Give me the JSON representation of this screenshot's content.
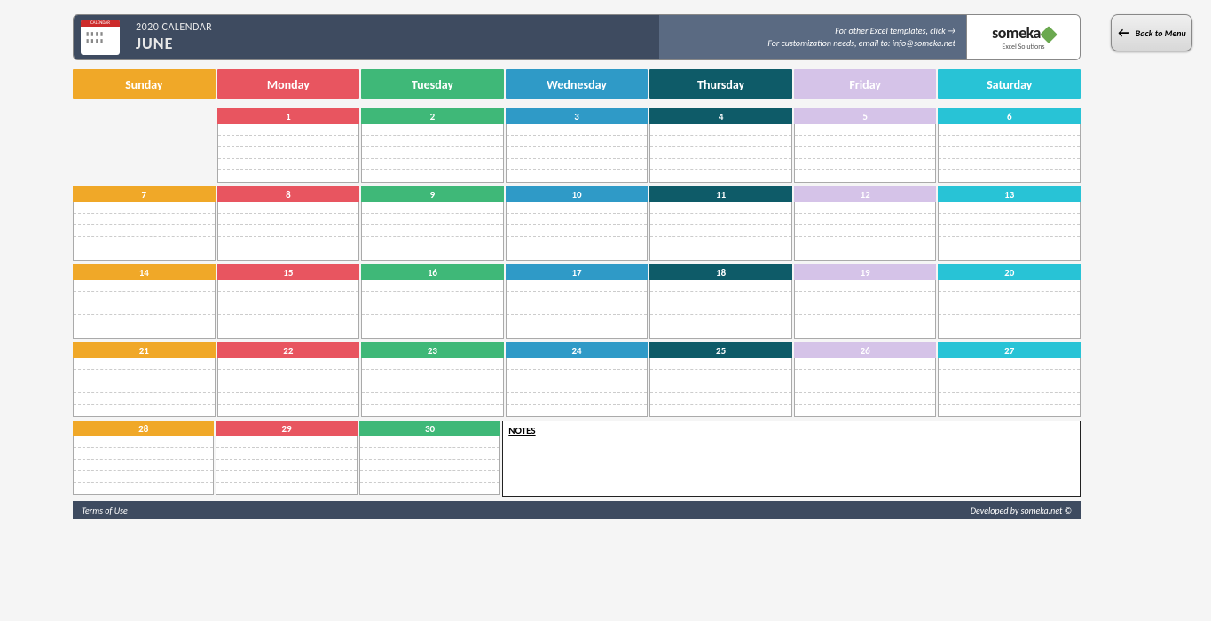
{
  "header": {
    "year_label": "2020 CALENDAR",
    "month": "JUNE",
    "templates_text": "For other Excel templates, click →",
    "custom_text": "For customization needs, email to: info@someka.net",
    "logo_name": "someka",
    "logo_sub": "Excel Solutions"
  },
  "back_button": "Back to Menu",
  "days": [
    "Sunday",
    "Monday",
    "Tuesday",
    "Wednesday",
    "Thursday",
    "Friday",
    "Saturday"
  ],
  "day_classes": [
    "sun",
    "mon",
    "tue",
    "wed",
    "thu",
    "fri",
    "sat"
  ],
  "weeks": [
    [
      null,
      1,
      2,
      3,
      4,
      5,
      6
    ],
    [
      7,
      8,
      9,
      10,
      11,
      12,
      13
    ],
    [
      14,
      15,
      16,
      17,
      18,
      19,
      20
    ],
    [
      21,
      22,
      23,
      24,
      25,
      26,
      27
    ],
    [
      28,
      29,
      30,
      null,
      null,
      null,
      null
    ]
  ],
  "notes_label": "NOTES",
  "footer": {
    "terms": "Terms of Use",
    "credit": "Developed by someka.net ©"
  }
}
